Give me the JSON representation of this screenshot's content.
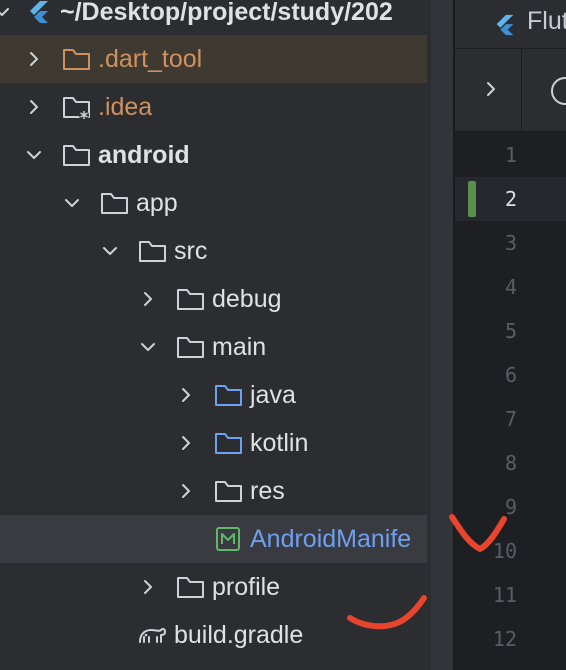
{
  "project_tree": {
    "root_path": "~/Desktop/project/study/202",
    "items": [
      {
        "label": ".dart_tool"
      },
      {
        "label": ".idea"
      },
      {
        "label": "android"
      },
      {
        "label": "app"
      },
      {
        "label": "src"
      },
      {
        "label": "debug"
      },
      {
        "label": "main"
      },
      {
        "label": "java"
      },
      {
        "label": "kotlin"
      },
      {
        "label": "res"
      },
      {
        "label": "AndroidManife"
      },
      {
        "label": "profile"
      },
      {
        "label": "build.gradle"
      }
    ]
  },
  "editor": {
    "tab_label": "Flut",
    "line_numbers": [
      "1",
      "2",
      "3",
      "4",
      "5",
      "6",
      "7",
      "8",
      "9",
      "10",
      "11",
      "12"
    ],
    "current_line": "2"
  },
  "colors": {
    "panel_bg": "#2b2d30",
    "editor_bg": "#1e1f22",
    "selection_bg": "#393b40",
    "folder_excluded": "#d1915f",
    "source_folder_blue": "#6f9ff1",
    "annotation_red": "#e8442e"
  }
}
